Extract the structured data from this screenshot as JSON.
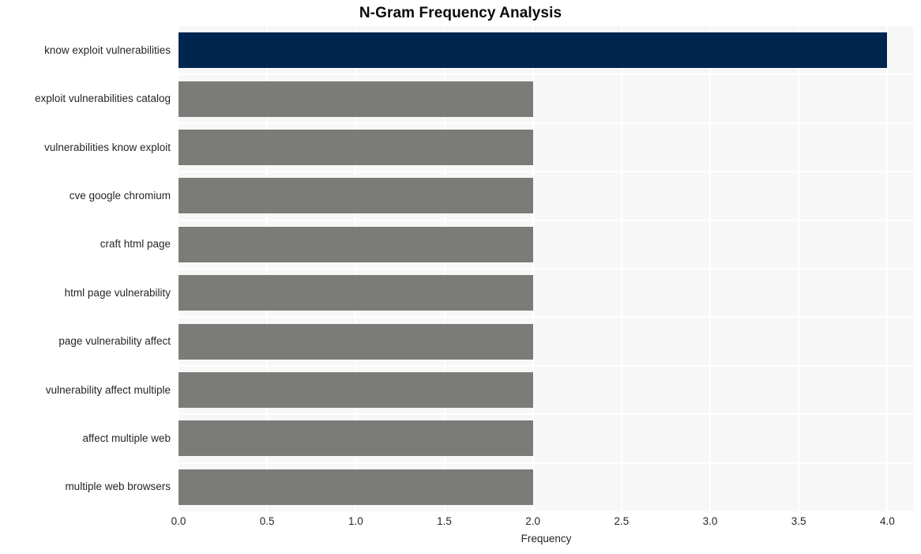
{
  "chart_data": {
    "type": "bar",
    "orientation": "horizontal",
    "title": "N-Gram Frequency Analysis",
    "xlabel": "Frequency",
    "ylabel": "",
    "xlim": [
      0,
      4.15
    ],
    "ylim": [
      0,
      10
    ],
    "grid": true,
    "legend": null,
    "xticks": [
      "0.0",
      "0.5",
      "1.0",
      "1.5",
      "2.0",
      "2.5",
      "3.0",
      "3.5",
      "4.0"
    ],
    "xtick_values": [
      0.0,
      0.5,
      1.0,
      1.5,
      2.0,
      2.5,
      3.0,
      3.5,
      4.0
    ],
    "categories": [
      "know exploit vulnerabilities",
      "exploit vulnerabilities catalog",
      "vulnerabilities know exploit",
      "cve google chromium",
      "craft html page",
      "html page vulnerability",
      "page vulnerability affect",
      "vulnerability affect multiple",
      "affect multiple web",
      "multiple web browsers"
    ],
    "values": [
      4,
      2,
      2,
      2,
      2,
      2,
      2,
      2,
      2,
      2
    ],
    "bar_colors": [
      "#00254f",
      "#7b7b78",
      "#7b7b78",
      "#7b7b78",
      "#7b7b78",
      "#7b7b78",
      "#7b7b78",
      "#7b7b78",
      "#7b7b78",
      "#7b7b78"
    ],
    "colors": {
      "highlight": "#00254f",
      "default_bar": "#7b7b78",
      "plot_background": "#f7f7f7",
      "figure_background": "#ffffff",
      "gridline": "#ffffff",
      "text": "#262626",
      "title_text": "#0a0a0a"
    }
  }
}
